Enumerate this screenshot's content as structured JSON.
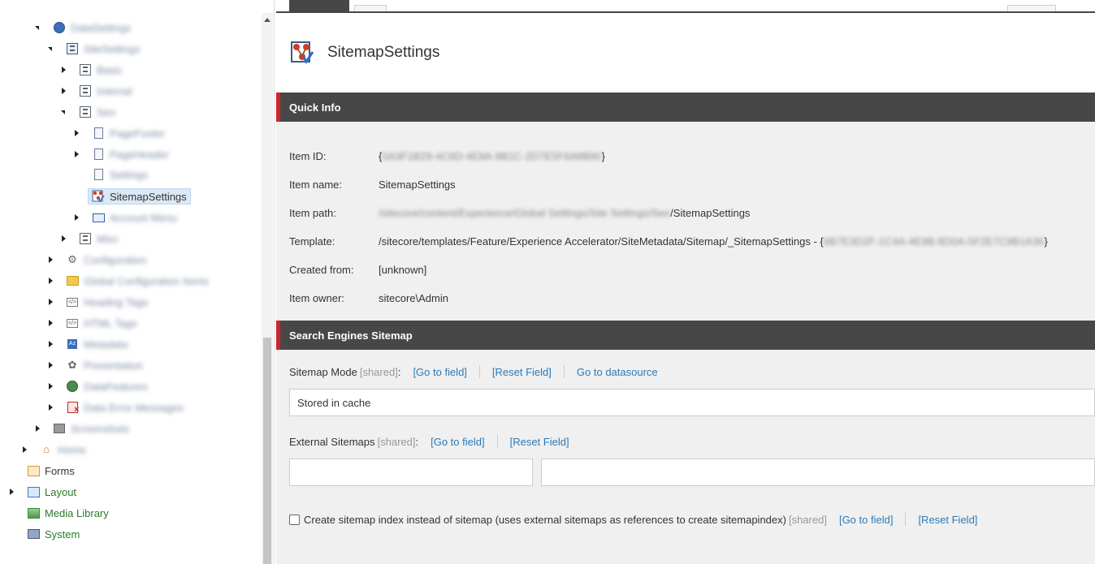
{
  "tree": {
    "items": [
      {
        "label": "DataSettings",
        "blurred": true,
        "state": "expanded",
        "icon": "globe-icon"
      },
      {
        "label": "SiteSettings",
        "blurred": true,
        "state": "expanded",
        "icon": "settings-box-icon"
      },
      {
        "label": "Basic",
        "blurred": true,
        "state": "collapsed",
        "icon": "box-icon"
      },
      {
        "label": "Internal",
        "blurred": true,
        "state": "collapsed",
        "icon": "box-icon"
      },
      {
        "label": "Seo",
        "blurred": true,
        "state": "expanded",
        "icon": "box-icon"
      },
      {
        "label": "PageFooter",
        "blurred": true,
        "state": "collapsed",
        "icon": "document-icon"
      },
      {
        "label": "PageHeader",
        "blurred": true,
        "state": "collapsed",
        "icon": "document-icon"
      },
      {
        "label": "Settings",
        "blurred": true,
        "state": "none",
        "icon": "document-icon"
      },
      {
        "label": "SitemapSettings",
        "blurred": false,
        "state": "none",
        "icon": "sitemap-icon",
        "selected": true
      },
      {
        "label": "Account Menu",
        "blurred": true,
        "state": "collapsed",
        "icon": "navigation-icon"
      },
      {
        "label": "Misc",
        "blurred": true,
        "state": "collapsed",
        "icon": "box-icon"
      },
      {
        "label": "Configuration",
        "blurred": true,
        "state": "collapsed",
        "icon": "gear-icon"
      },
      {
        "label": "Global Configuration Items",
        "blurred": true,
        "state": "collapsed",
        "icon": "folder-icon"
      },
      {
        "label": "Heading Tags",
        "blurred": true,
        "state": "collapsed",
        "icon": "code-icon"
      },
      {
        "label": "HTML Tags",
        "blurred": true,
        "state": "collapsed",
        "icon": "code-icon"
      },
      {
        "label": "Metadata",
        "blurred": true,
        "state": "collapsed",
        "icon": "az-icon"
      },
      {
        "label": "Presentation",
        "blurred": true,
        "state": "collapsed",
        "icon": "palette-icon"
      },
      {
        "label": "DataFeatures",
        "blurred": true,
        "state": "collapsed",
        "icon": "globe-gear-icon"
      },
      {
        "label": "Data Error Messages",
        "blurred": true,
        "state": "collapsed",
        "icon": "error-doc-icon"
      },
      {
        "label": "Screenshots",
        "blurred": true,
        "state": "collapsed",
        "icon": "screen-icon"
      },
      {
        "label": "Home",
        "blurred": true,
        "state": "collapsed",
        "icon": "home-icon"
      },
      {
        "label": "Forms",
        "blurred": false,
        "state": "none",
        "icon": "forms-icon"
      },
      {
        "label": "Layout",
        "blurred": false,
        "state": "collapsed",
        "icon": "layout-icon"
      },
      {
        "label": "Media Library",
        "blurred": false,
        "state": "none",
        "icon": "media-library-icon"
      },
      {
        "label": "System",
        "blurred": false,
        "state": "none",
        "icon": "system-icon"
      }
    ]
  },
  "item": {
    "title": "SitemapSettings"
  },
  "quick_info": {
    "header": "Quick Info",
    "item_id_label": "Item ID:",
    "item_id_open": "{",
    "item_id_value": "0A3F1B29-4C6D-4E8A-9B1C-2D7E5F6A8B90",
    "item_id_close": "}",
    "item_name_label": "Item name:",
    "item_name_value": "SitemapSettings",
    "item_path_label": "Item path:",
    "item_path_hidden": "/sitecore/content/Experience/Global Settings/Site Settings/Seo",
    "item_path_visible": "/SitemapSettings",
    "template_label": "Template:",
    "template_value": "/sitecore/templates/Feature/Experience Accelerator/SiteMetadata/Sitemap/_SitemapSettings - {",
    "template_hidden": "6B7E3D2F-1C4A-4E9B-8D0A-5F2E7C9B1A36",
    "template_close": "}",
    "created_from_label": "Created from:",
    "created_from_value": "[unknown]",
    "item_owner_label": "Item owner:",
    "item_owner_value": "sitecore\\Admin"
  },
  "sitemap_section": {
    "header": "Search Engines Sitemap",
    "sitemap_mode": {
      "label": "Sitemap Mode",
      "shared": "[shared]",
      "colon": ":",
      "go_to_field": "[Go to field]",
      "reset_field": "[Reset Field]",
      "go_to_datasource": "Go to datasource",
      "value": "Stored in cache"
    },
    "external_sitemaps": {
      "label": "External Sitemaps",
      "shared": "[shared]",
      "colon": ":",
      "go_to_field": "[Go to field]",
      "reset_field": "[Reset Field]",
      "value_left": "",
      "value_right": ""
    },
    "sitemap_index": {
      "label": "Create sitemap index instead of sitemap (uses external sitemaps as references to create sitemapindex)",
      "shared": "[shared]",
      "go_to_field": "[Go to field]",
      "reset_field": "[Reset Field]",
      "checked": false
    }
  },
  "colors": {
    "section_header_bg": "#474747",
    "section_accent": "#d0232a",
    "link": "#2a7ab8",
    "selected_bg": "#dbe9f6"
  }
}
